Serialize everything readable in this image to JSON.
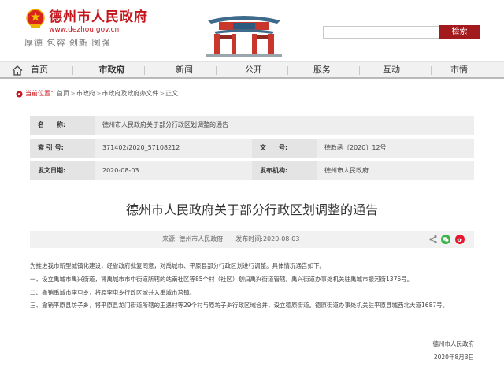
{
  "header": {
    "site_title": "德州市人民政府",
    "site_url": "www.dezhou.gov.cn",
    "slogan": "厚德  包容  创新  图强",
    "search": {
      "placeholder": "",
      "button_label": "检索"
    }
  },
  "nav": {
    "items": [
      {
        "label": "首页",
        "active": false
      },
      {
        "label": "市政府",
        "active": true
      },
      {
        "label": "新闻",
        "active": false
      },
      {
        "label": "公开",
        "active": false
      },
      {
        "label": "服务",
        "active": false
      },
      {
        "label": "互动",
        "active": false
      },
      {
        "label": "市情",
        "active": false
      }
    ]
  },
  "breadcrumb": {
    "prefix": "当前位置：",
    "items": [
      "首页",
      "市政府",
      "市政府及政府办文件",
      "正文"
    ],
    "separator": ">"
  },
  "info": {
    "name_label": "名　　称:",
    "name_value": "德州市人民政府关于部分行政区划调整的通告",
    "index_label": "索 引 号:",
    "index_value": "371402/2020_57108212",
    "doc_no_label": "文　　号:",
    "doc_no_value": "德政函〔2020〕12号",
    "date_label": "发文日期:",
    "date_value": "2020-08-03",
    "org_label": "发布机构:",
    "org_value": "德州市人民政府"
  },
  "article": {
    "title": "德州市人民政府关于部分行政区划调整的通告",
    "source": "来源: 德州市人民政府",
    "published": "发布时间:2020-08-03",
    "paragraphs": [
      "为推进我市新型城镇化建设，经省政府批复同意，对禹城市、平原县部分行政区划进行调整。具体情况通告如下。",
      "一、设立禹城市禹兴街道，将禹城市市中街道所辖的站南社区等85个村（社区）划归禹兴街道管辖。禹兴街道办事处机关驻禹城市振河街1376号。",
      "二、撤销禹城市李屯乡，将原李屯乡行政区域并入禹城市莒镇。",
      "三、撤销平原县坊子乡，将平原县龙门街道所辖的王遇村等29个村与原坊子乡行政区域合并，设立德原街道。德原街道办事处机关驻平原县城西北大道1687号。"
    ],
    "signature_org": "德州市人民政府",
    "signature_date": "2020年8月3日"
  },
  "colors": {
    "brand_red": "#c4161c",
    "button_red": "#a31a1e",
    "wechat_green": "#3bb249",
    "weibo_red": "#e6162d"
  },
  "icons": {
    "emblem": "national-emblem-icon",
    "gate": "archway-gate-image",
    "home": "home-icon",
    "share": "share-icon",
    "wechat": "wechat-icon",
    "weibo": "weibo-icon"
  }
}
